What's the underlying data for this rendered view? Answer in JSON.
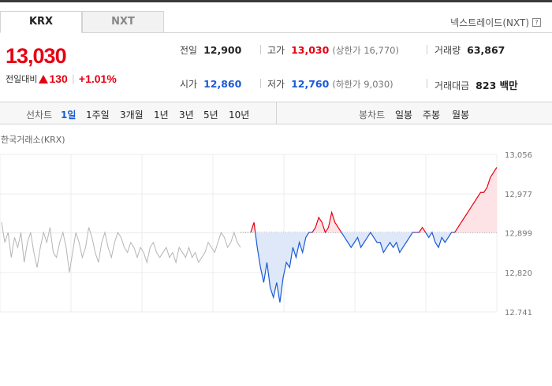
{
  "tabs": [
    {
      "label": "KRX",
      "active": true
    },
    {
      "label": "NXT",
      "active": false
    }
  ],
  "nxt_link": {
    "label": "넥스트레이드(NXT)",
    "help": "?"
  },
  "quote": {
    "price": "13,030",
    "change_label": "전일대비",
    "change_amount": "130",
    "change_percent": "+1.01%",
    "direction": "up"
  },
  "stats": {
    "prev_close": {
      "label": "전일",
      "value": "12,900"
    },
    "high": {
      "label": "고가",
      "value": "13,030",
      "sub": "(상한가 16,770)"
    },
    "volume": {
      "label": "거래량",
      "value": "63,867"
    },
    "open": {
      "label": "시가",
      "value": "12,860"
    },
    "low": {
      "label": "저가",
      "value": "12,760",
      "sub": "(하한가 9,030)"
    },
    "turnover": {
      "label": "거래대금",
      "value": "823 백만"
    }
  },
  "controls": {
    "line_label": "선차트",
    "line_periods": [
      "1일",
      "1주일",
      "3개월",
      "1년",
      "3년",
      "5년",
      "10년"
    ],
    "line_active": "1일",
    "candle_label": "봉차트",
    "candle_periods": [
      "일봉",
      "주봉",
      "월봉"
    ]
  },
  "exchange_label": "한국거래소(KRX)",
  "colors": {
    "up": "#e60012",
    "down": "#1a5bd6",
    "prev_day": "#b5b5b5"
  },
  "chart_data": {
    "type": "line",
    "ylim": [
      12741,
      13056
    ],
    "yticks": [
      13056,
      12977,
      12899,
      12820,
      12741
    ],
    "baseline": 12900,
    "grid": true,
    "prev_day_series": [
      12920,
      12880,
      12900,
      12850,
      12890,
      12870,
      12900,
      12840,
      12880,
      12900,
      12860,
      12830,
      12870,
      12900,
      12880,
      12910,
      12860,
      12850,
      12880,
      12900,
      12870,
      12820,
      12860,
      12900,
      12880,
      12850,
      12870,
      12910,
      12890,
      12860,
      12840,
      12880,
      12900,
      12870,
      12850,
      12880,
      12900,
      12890,
      12870,
      12860,
      12880,
      12870,
      12850,
      12870,
      12860,
      12840,
      12870,
      12880,
      12860,
      12850,
      12860,
      12870,
      12850,
      12860,
      12840,
      12870,
      12860,
      12850,
      12870,
      12850,
      12860,
      12840,
      12850,
      12860,
      12880,
      12870,
      12860,
      12880,
      12900,
      12890,
      12870,
      12880,
      12900,
      12880,
      12870
    ],
    "today_series": [
      12900,
      12920,
      12870,
      12830,
      12800,
      12840,
      12790,
      12770,
      12800,
      12760,
      12810,
      12840,
      12830,
      12870,
      12850,
      12880,
      12860,
      12890,
      12900,
      12900,
      12910,
      12930,
      12920,
      12900,
      12910,
      12940,
      12920,
      12910,
      12900,
      12890,
      12880,
      12870,
      12880,
      12890,
      12870,
      12880,
      12890,
      12900,
      12890,
      12880,
      12880,
      12860,
      12870,
      12880,
      12870,
      12880,
      12860,
      12870,
      12880,
      12890,
      12900,
      12900,
      12900,
      12910,
      12900,
      12890,
      12900,
      12880,
      12870,
      12890,
      12880,
      12890,
      12900,
      12900,
      12910,
      12920,
      12930,
      12940,
      12950,
      12960,
      12970,
      12980,
      12980,
      12990,
      13010,
      13020,
      13030
    ]
  }
}
